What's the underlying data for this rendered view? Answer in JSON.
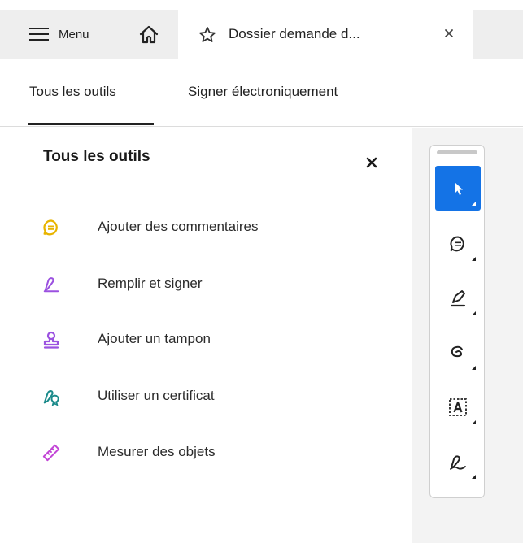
{
  "tabbar": {
    "menu_label": "Menu",
    "document_tab_title": "Dossier demande d...",
    "icons": [
      "hamburger-icon",
      "home-icon",
      "star-icon",
      "close-icon"
    ]
  },
  "subtabs": [
    {
      "label": "Tous les outils",
      "selected": true
    },
    {
      "label": "Signer électroniquement",
      "selected": false
    }
  ],
  "panel": {
    "title": "Tous les outils",
    "tools": [
      {
        "label": "Ajouter des commentaires",
        "icon": "comment-icon",
        "color": "#e8b400"
      },
      {
        "label": "Remplir et signer",
        "icon": "fill-sign-icon",
        "color": "#9b51e0"
      },
      {
        "label": "Ajouter un tampon",
        "icon": "stamp-icon",
        "color": "#9b51e0"
      },
      {
        "label": "Utiliser un certificat",
        "icon": "certificate-icon",
        "color": "#1a8a8a"
      },
      {
        "label": "Mesurer des objets",
        "icon": "ruler-icon",
        "color": "#c245d6"
      }
    ]
  },
  "quick_toolbar": {
    "buttons": [
      {
        "name": "select-tool",
        "icon": "cursor-icon",
        "active": true
      },
      {
        "name": "comment-tool",
        "icon": "comment-icon",
        "active": false
      },
      {
        "name": "highlight-tool",
        "icon": "highlighter-icon",
        "active": false
      },
      {
        "name": "draw-tool",
        "icon": "lasso-icon",
        "active": false
      },
      {
        "name": "text-select-tool",
        "icon": "text-box-icon",
        "active": false
      },
      {
        "name": "sign-tool",
        "icon": "signature-icon",
        "active": false
      }
    ]
  },
  "colors": {
    "accent": "#1473e6",
    "tabbar_bg": "#eeeeee",
    "canvas_bg": "#f3f3f3"
  }
}
